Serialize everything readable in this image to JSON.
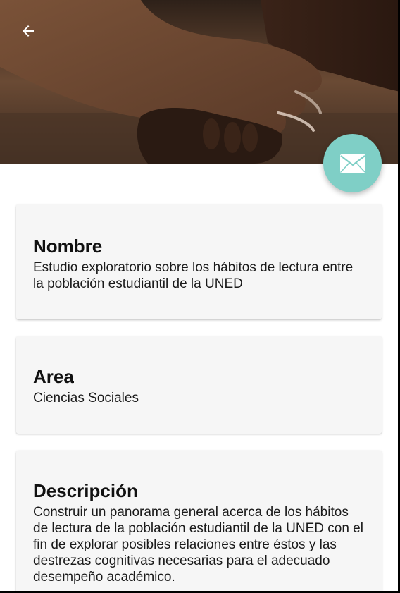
{
  "header": {
    "back_icon": "arrow-left-icon",
    "photo_alt": "hands-stacked-photo"
  },
  "fab": {
    "icon": "envelope-icon",
    "color": "#7fcfc6"
  },
  "cards": {
    "nombre": {
      "title": "Nombre",
      "text": "Estudio exploratorio sobre los hábitos de lectura entre la población estudiantil de la UNED"
    },
    "area": {
      "title": "Area",
      "text": "Ciencias Sociales"
    },
    "descripcion": {
      "title": "Descripción",
      "text": "Construir un panorama general acerca de los hábitos de lectura de la población estudiantil de la UNED con el fin de explorar posibles relaciones entre éstos y las destrezas cognitivas necesarias para el adecuado desempeño académico."
    }
  }
}
